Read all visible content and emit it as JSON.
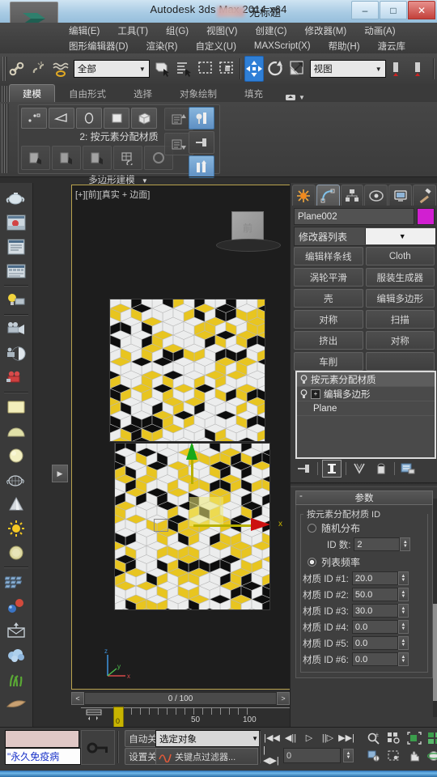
{
  "window": {
    "title": "Autodesk 3ds Max  2014 x64",
    "document_title": "无标题",
    "minimize": "–",
    "maximize": "□",
    "close": "✕"
  },
  "menu": {
    "row1": [
      "编辑(E)",
      "工具(T)",
      "组(G)",
      "视图(V)",
      "创建(C)",
      "修改器(M)",
      "动画(A)"
    ],
    "row2": [
      "图形编辑器(D)",
      "渲染(R)",
      "自定义(U)",
      "MAXScript(X)",
      "帮助(H)",
      "溏云库"
    ]
  },
  "toolbar": {
    "selection_filter": "全部",
    "reference_coordinate_system": "视图",
    "buttons": [
      {
        "name": "select-and-link",
        "icon": "link-icon"
      },
      {
        "name": "unlink-selection",
        "icon": "unlink-icon"
      },
      {
        "name": "bind-to-space-warp",
        "icon": "spacewarp-icon"
      },
      {
        "name": "select-object",
        "icon": "select-cursor-icon"
      },
      {
        "name": "select-by-name",
        "icon": "select-by-name-icon"
      },
      {
        "name": "rectangular-select-region",
        "icon": "rect-select-icon"
      },
      {
        "name": "window-crossing-toggle",
        "icon": "crossing-icon"
      },
      {
        "name": "select-and-move",
        "icon": "move-icon"
      },
      {
        "name": "select-and-rotate",
        "icon": "rotate-icon"
      },
      {
        "name": "select-and-scale",
        "icon": "scale-icon"
      },
      {
        "name": "use-pivot-point-center",
        "icon": "pivot-icon"
      },
      {
        "name": "mirror",
        "icon": "mirror-icon"
      }
    ]
  },
  "ribbon": {
    "tabs": [
      {
        "label": "建模",
        "active": true
      },
      {
        "label": "自由形式",
        "active": false
      },
      {
        "label": "选择",
        "active": false
      },
      {
        "label": "对象绘制",
        "active": false
      },
      {
        "label": "填充",
        "active": false
      }
    ],
    "panel": {
      "subobject_label": "2: 按元素分配材质",
      "footer_label": "多边形建模",
      "subobject_icons": [
        "vertex-icon",
        "edge-icon",
        "border-icon",
        "polygon-icon",
        "element-icon"
      ],
      "tools_icons": [
        "generate-topology-icon",
        "symmetry-tool-icon",
        "make-planar-icon",
        "repeat-last-icon",
        "ngon-icon"
      ],
      "side_icons": [
        "preserve-up-icon",
        "preserve-down-icon"
      ],
      "right_icons": [
        "show-end-result-icon",
        "pin-stack-icon",
        "display-toggle-icon"
      ]
    }
  },
  "material_bar": {
    "items": [
      {
        "name": "teapot-sample-icon",
        "glyph": "teapot"
      },
      {
        "name": "render-preview-icon",
        "glyph": "render"
      },
      {
        "name": "material-list-icon",
        "glyph": "list"
      },
      {
        "name": "material-table-icon",
        "glyph": "table"
      },
      {
        "name": "light-icon",
        "glyph": "bulb"
      },
      {
        "name": "camera-icon",
        "glyph": "camera"
      },
      {
        "name": "camera-sphere-icon",
        "glyph": "camsphere"
      },
      {
        "name": "camera-red-icon",
        "glyph": "camred"
      },
      {
        "name": "plane-sample-icon",
        "glyph": "planeswatch"
      },
      {
        "name": "dome-sample-icon",
        "glyph": "dome"
      },
      {
        "name": "sphere-sample-icon",
        "glyph": "sphere"
      },
      {
        "name": "wire-teapot-icon",
        "glyph": "wireteapot"
      },
      {
        "name": "cone-sample-icon",
        "glyph": "cone"
      },
      {
        "name": "sun-icon",
        "glyph": "sun"
      },
      {
        "name": "disc-sample-icon",
        "glyph": "disc"
      },
      {
        "name": "array-icon",
        "glyph": "array"
      },
      {
        "name": "molecule-icon",
        "glyph": "molecule"
      },
      {
        "name": "envelope-icon",
        "glyph": "envelope"
      },
      {
        "name": "cloud-icon",
        "glyph": "cloud"
      },
      {
        "name": "grass-icon",
        "glyph": "grass"
      },
      {
        "name": "leaf-icon",
        "glyph": "leaf"
      }
    ]
  },
  "viewport": {
    "label": "[+][前][真实 + 边面]",
    "object_label": "前",
    "axis_x_label": "x",
    "axis_tripod": {
      "z": "z",
      "y": "y",
      "x": "x"
    },
    "expand_arrow": "▶",
    "pattern": {
      "description": "rhombille tessellation of white, yellow and black diamonds",
      "colors": [
        "#eceded",
        "#e8c520",
        "#0d0d0d"
      ],
      "background": "#e9e9e9"
    }
  },
  "timeline": {
    "prev_button": "<",
    "next_button": ">",
    "frame_display": "0 / 100",
    "ruler_labels": [
      "0",
      "50",
      "100"
    ],
    "slider_label": "0",
    "track_icon": "track-view-icon"
  },
  "command_panel": {
    "tabs": [
      {
        "name": "create-tab",
        "icon": "star-icon",
        "active": false
      },
      {
        "name": "modify-tab",
        "icon": "arc-icon",
        "active": true
      },
      {
        "name": "hierarchy-tab",
        "icon": "hierarchy-icon",
        "active": false
      },
      {
        "name": "motion-tab",
        "icon": "motion-icon",
        "active": false
      },
      {
        "name": "display-tab",
        "icon": "display-icon",
        "active": false
      },
      {
        "name": "utilities-tab",
        "icon": "hammer-icon",
        "active": false
      }
    ],
    "object_name": "Plane002",
    "object_color": "#d11fd1",
    "modifier_list_label": "修改器列表",
    "modifier_buttons": [
      [
        "编辑样条线",
        "Cloth"
      ],
      [
        "涡轮平滑",
        "服装生成器"
      ],
      [
        "壳",
        "编辑多边形"
      ],
      [
        "对称",
        "扫描"
      ],
      [
        "挤出",
        "对称"
      ],
      [
        "车削",
        ""
      ]
    ],
    "modifier_stack": [
      {
        "label": "按元素分配材质",
        "selected": true,
        "has_plus": false
      },
      {
        "label": "编辑多边形",
        "selected": false,
        "has_plus": true
      },
      {
        "label": "Plane",
        "selected": false,
        "has_plus": false,
        "indent": true
      }
    ],
    "stack_buttons": [
      {
        "name": "pin-stack-button",
        "icon": "pin-icon"
      },
      {
        "name": "show-end-result-button",
        "icon": "end-result-icon"
      },
      {
        "name": "make-unique-button",
        "icon": "unique-icon"
      },
      {
        "name": "remove-modifier-button",
        "icon": "trash-icon"
      },
      {
        "name": "configure-modifier-sets-button",
        "icon": "config-icon"
      }
    ],
    "rollout": {
      "title": "参数",
      "collapse_glyph": "-",
      "group_title": "按元素分配材质 ID",
      "radios": [
        {
          "label": "随机分布",
          "selected": false
        },
        {
          "label": "列表频率",
          "selected": true
        }
      ],
      "id_count_label": "ID 数:",
      "id_count_value": "2",
      "material_ids": [
        {
          "label": "材质 ID #1:",
          "value": "20.0"
        },
        {
          "label": "材质 ID #2:",
          "value": "50.0"
        },
        {
          "label": "材质 ID #3:",
          "value": "30.0"
        },
        {
          "label": "材质 ID #4:",
          "value": "0.0"
        },
        {
          "label": "材质 ID #5:",
          "value": "0.0"
        },
        {
          "label": "材质 ID #6:",
          "value": "0.0"
        }
      ]
    }
  },
  "status_bar": {
    "status_text": "\"永久免疫病",
    "auto_key_label": "自动关键点",
    "set_key_label": "设置关键点",
    "selection_set": "选定对象",
    "key_filters_label": "关键点过滤器...",
    "frame_value": "0",
    "playback_buttons": [
      {
        "name": "go-to-start-button",
        "glyph": "|◀◀"
      },
      {
        "name": "previous-frame-button",
        "glyph": "◀||"
      },
      {
        "name": "play-button",
        "glyph": "▷"
      },
      {
        "name": "next-frame-button",
        "glyph": "||▷"
      },
      {
        "name": "go-to-end-button",
        "glyph": "▶▶|"
      }
    ],
    "nav_buttons": [
      {
        "name": "zoom-button",
        "icon": "zoom-icon"
      },
      {
        "name": "zoom-all-button",
        "icon": "zoom-all-icon"
      },
      {
        "name": "zoom-extents-button",
        "icon": "zoom-extents-icon"
      },
      {
        "name": "zoom-extents-all-button",
        "icon": "zoom-extents-all-icon"
      },
      {
        "name": "field-of-view-button",
        "icon": "fov-icon"
      },
      {
        "name": "region-zoom-button",
        "icon": "region-zoom-icon"
      },
      {
        "name": "pan-button",
        "icon": "hand-icon"
      },
      {
        "name": "orbit-button",
        "icon": "orbit-icon"
      },
      {
        "name": "maximize-viewport-button",
        "icon": "maximize-viewport-icon"
      }
    ],
    "key_mode_button": "|◀▶|"
  }
}
